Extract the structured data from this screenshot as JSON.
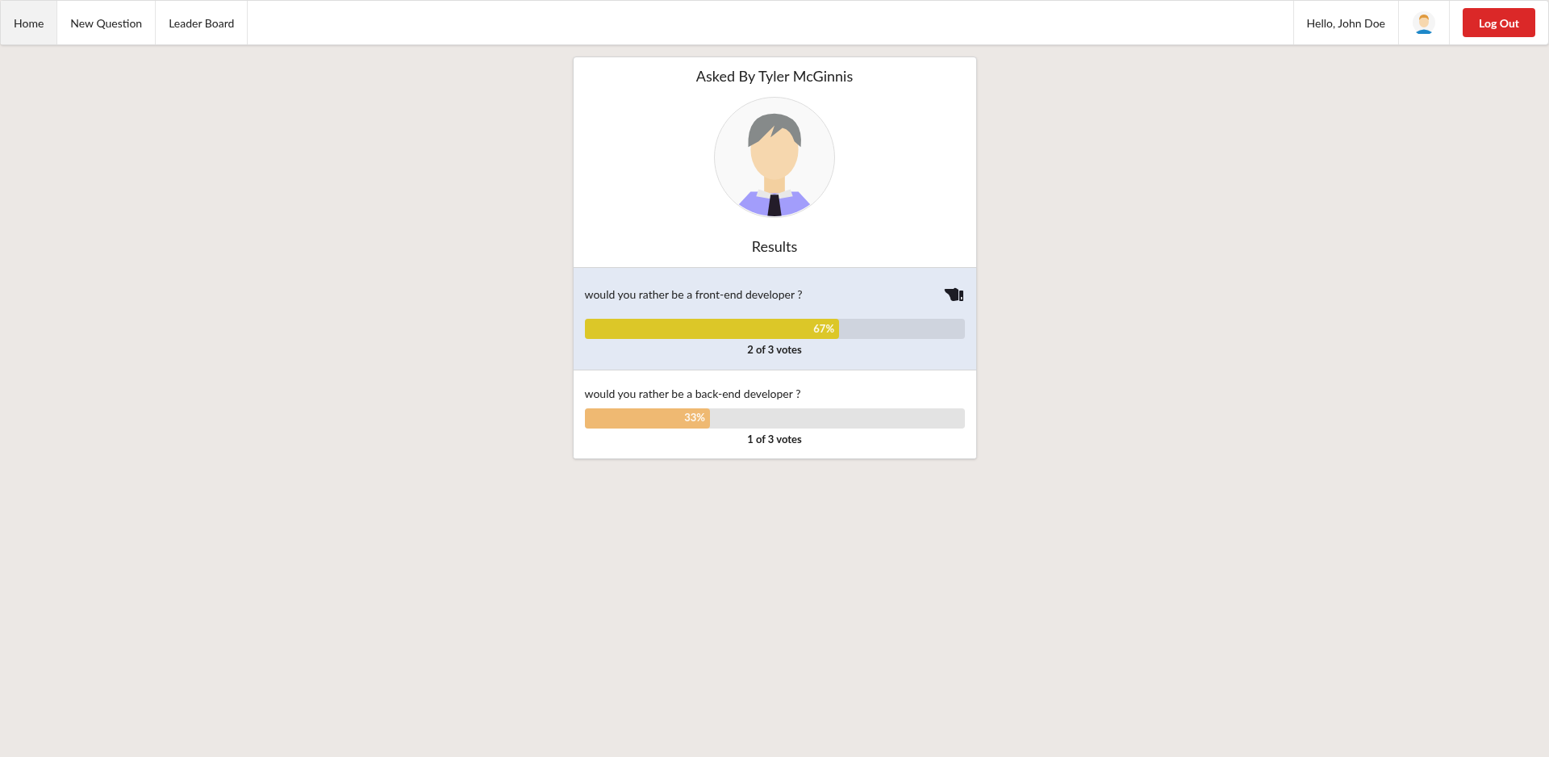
{
  "nav": {
    "tabs": [
      {
        "label": "Home",
        "selected": true
      },
      {
        "label": "New Question",
        "selected": false
      },
      {
        "label": "Leader Board",
        "selected": false
      }
    ],
    "greeting": "Hello, John Doe",
    "logout": "Log Out"
  },
  "card": {
    "title": "Asked By Tyler McGinnis",
    "heading": "Results",
    "options": [
      {
        "text": "would you rather be a front-end developer ?",
        "selected": true,
        "level": 0.67,
        "percent": "67%",
        "votes": "2 of 3 votes",
        "color": "#dcc728"
      },
      {
        "text": "would you rather be a back-end developer ?",
        "selected": false,
        "level": 0.33,
        "percent": "33%",
        "votes": "1 of 3 votes",
        "color": "#efb972"
      }
    ]
  }
}
